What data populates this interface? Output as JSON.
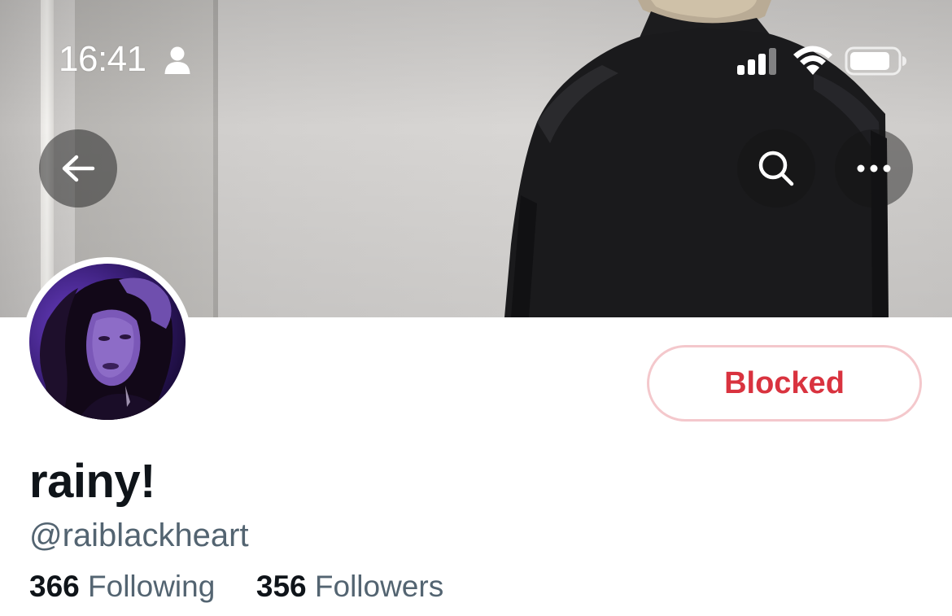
{
  "status_bar": {
    "time": "16:41",
    "icons": [
      "person-icon",
      "cellular-signal-icon",
      "wifi-icon",
      "battery-icon"
    ]
  },
  "nav": {
    "back_icon": "arrow-left-icon",
    "search_icon": "search-icon",
    "more_icon": "more-horizontal-icon"
  },
  "profile": {
    "display_name": "rainy!",
    "handle": "@raiblackheart",
    "following_count": "366",
    "following_label": "Following",
    "followers_count": "356",
    "followers_label": "Followers",
    "blocked_label": "Blocked"
  },
  "colors": {
    "blocked_text": "#d9333f",
    "blocked_border": "#f4c8cc",
    "primary_text": "#0f1419",
    "secondary_text": "#536471",
    "avatar_tint": "#6a3fc4"
  }
}
